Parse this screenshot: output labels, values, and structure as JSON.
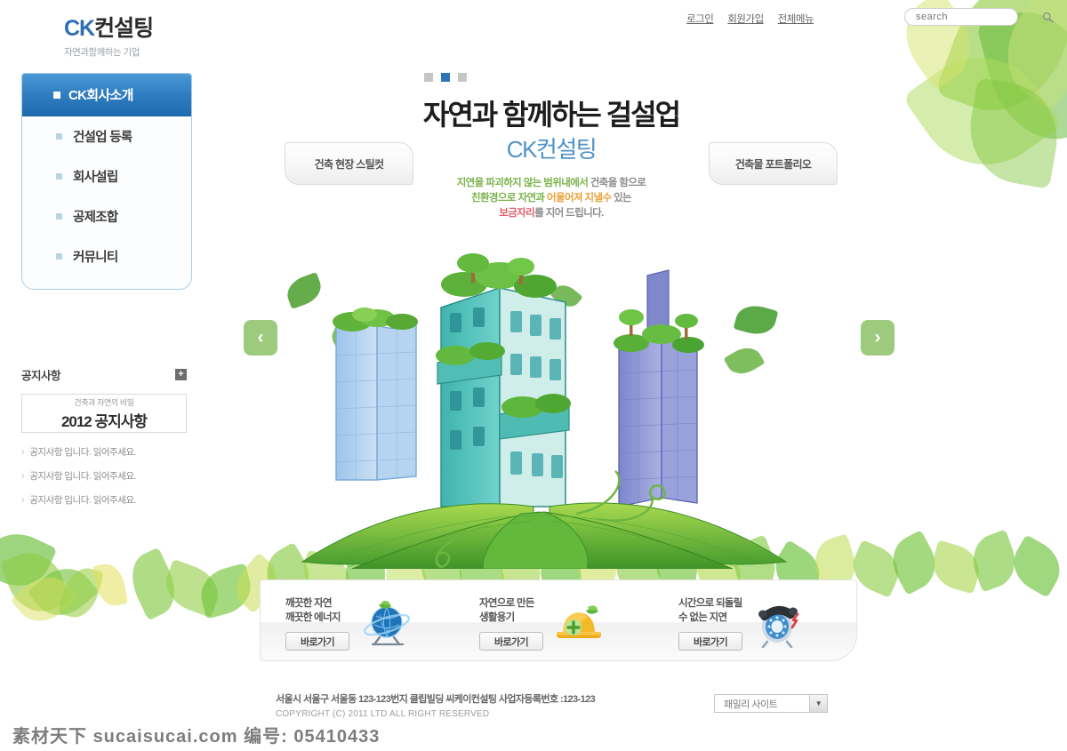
{
  "header": {
    "logo_main": "CK컨설팅",
    "logo_ck": "CK",
    "logo_rest": "컨설팅",
    "tagline": "자연과함께하는 기업",
    "topnav": [
      {
        "label": "로그인",
        "name": "login"
      },
      {
        "label": "회원가입",
        "name": "signup"
      },
      {
        "label": "전체메뉴",
        "name": "all-menu"
      }
    ],
    "search": {
      "placeholder": "search",
      "value": "",
      "icon": "search-icon"
    }
  },
  "sidebar": {
    "active_item": {
      "label": "CK회사소개"
    },
    "items": [
      {
        "label": "건설업 등록"
      },
      {
        "label": "회사설립"
      },
      {
        "label": "공제조합"
      },
      {
        "label": "커뮤니티"
      }
    ]
  },
  "notice": {
    "title": "공지사항",
    "plus_label": "+",
    "banner_sub": "건축과 자연의 비밀",
    "banner_main": "2012 공지사항",
    "items": [
      {
        "chevron": "›",
        "text": "공지사항 입니다. 읽어주세요."
      },
      {
        "chevron": "›",
        "text": "공지사항 입니다. 읽어주세요."
      },
      {
        "chevron": "›",
        "text": "공지사항 입니다. 읽어주세요."
      }
    ]
  },
  "hero": {
    "dots": {
      "count": 3,
      "active_index": 1
    },
    "title": "자연과 함께하는 걸설업",
    "subtitle": "CK컨설팅",
    "desc_line1_a": "지연을 파괴하지 않는 범위내에서 ",
    "desc_line1_b": "건축을 함으로",
    "desc_line2_a": "친환경으로 자연과 ",
    "desc_line2_b": "어울어져 지낼수 ",
    "desc_line2_c": "있는",
    "desc_line3_a": "보금자리",
    "desc_line3_b": "를 지어 드립니다.",
    "button_left": "건축 현장 스틸컷",
    "button_right": "건축물 포트폴리오",
    "arrow_left": "‹",
    "arrow_right": "›"
  },
  "quicklinks": [
    {
      "line1": "깨끗한 자연",
      "line2": "깨끗한 에너지",
      "button": "바로가기",
      "icon": "globe-icon"
    },
    {
      "line1": "자연으로 만든",
      "line2": "생활용기",
      "button": "바로가기",
      "icon": "hardhat-icon"
    },
    {
      "line1": "시간으로 되돌릴",
      "line2": "수 없는 지연",
      "button": "바로가기",
      "icon": "telephone-icon"
    }
  ],
  "footer": {
    "address": "서울시 서울구 서울동 123-123번지 클립빌딩 씨케이컨설팅 사업자등록번호 :123-123",
    "copyright": "COPYRIGHT (C) 2011 LTD ALL RIGHT RESERVED",
    "family_site": {
      "label": "패밀리 사이트",
      "caret": "▼"
    }
  },
  "watermark": {
    "brand": "素材天下",
    "domain": "sucaisucai.com",
    "id_label": "编号:",
    "id_value": "05410433"
  },
  "colors": {
    "accent_blue": "#2f7dc0",
    "leaf_green": "#9ccb7e",
    "text_green": "#7bb34b",
    "text_orange": "#eaa33c",
    "text_red": "#e0616b"
  }
}
